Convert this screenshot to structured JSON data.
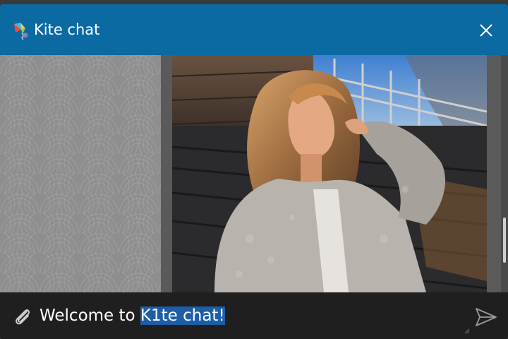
{
  "header": {
    "title": "Kite chat",
    "app_icon": "kite-icon",
    "close_icon": "close-icon",
    "color": "#0b6aa2"
  },
  "chat": {
    "background_pattern": "seigaiha-waves",
    "message_image": "photo-woman-in-fleece-jacket"
  },
  "composer": {
    "text_before_selection": "Welcome to ",
    "selected_text": "K1te chat!",
    "attach_icon": "paperclip-icon",
    "send_icon": "send-icon",
    "selection_color": "#1d5ea8"
  }
}
